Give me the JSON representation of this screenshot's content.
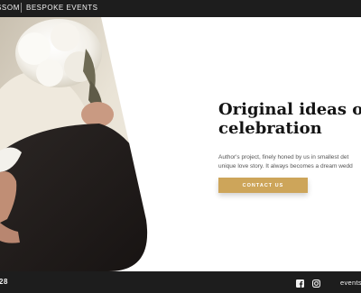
{
  "header": {
    "brand_name": "SSOM",
    "brand_tagline": "BESPOKE EVENTS"
  },
  "hero": {
    "headline_line1": "Original ideas o",
    "headline_line2": "celebration",
    "description_line1": "Author's project, finely honed by us in smallest det",
    "description_line2": "unique love story. It always becomes a dream wedd",
    "cta_label": "CONTACT US"
  },
  "footer": {
    "phone_fragment": "28",
    "social_icons": [
      "facebook-icon",
      "instagram-icon"
    ],
    "email_fragment": "events"
  },
  "colors": {
    "bar_background": "#1d1d1d",
    "accent_gold": "#cda55a",
    "headline_text": "#141414"
  }
}
